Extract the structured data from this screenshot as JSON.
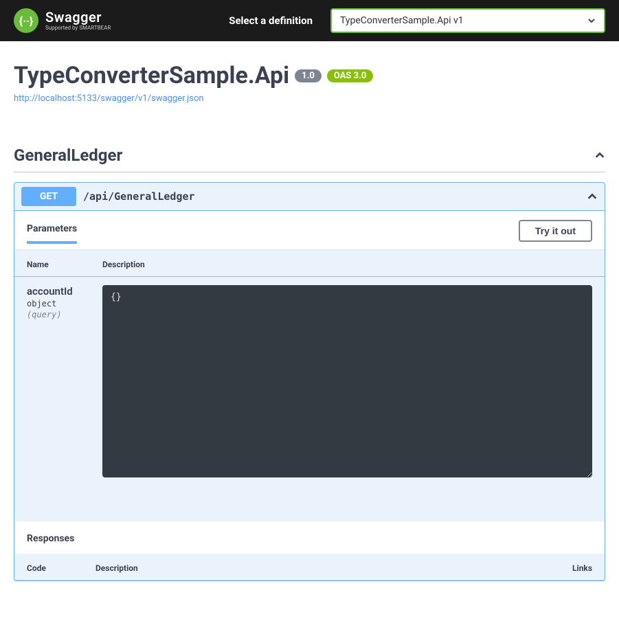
{
  "topbar": {
    "logo_text": "Swagger",
    "logo_subtext": "Supported by SMARTBEAR",
    "select_label": "Select a definition",
    "selected_definition": "TypeConverterSample.Api v1"
  },
  "header": {
    "title": "TypeConverterSample.Api",
    "version": "1.0",
    "oas_label": "OAS 3.0",
    "spec_url": "http://localhost:5133/swagger/v1/swagger.json"
  },
  "tag": {
    "name": "GeneralLedger"
  },
  "operation": {
    "method": "GET",
    "path": "/api/GeneralLedger",
    "parameters_tab": "Parameters",
    "try_button": "Try it out",
    "table": {
      "head_name": "Name",
      "head_description": "Description"
    },
    "param": {
      "name": "accountId",
      "type": "object",
      "in": "(query)",
      "body": "{}"
    },
    "responses": {
      "title": "Responses",
      "head_code": "Code",
      "head_description": "Description",
      "head_links": "Links"
    }
  }
}
